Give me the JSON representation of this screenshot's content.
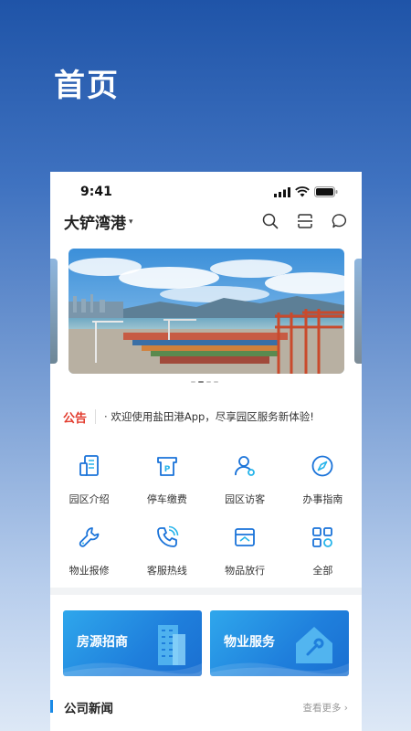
{
  "promo": {
    "title": "首页"
  },
  "status_bar": {
    "time": "9:41"
  },
  "header": {
    "location": "大铲湾港",
    "location_caret": "▾"
  },
  "notice": {
    "tag": "公告",
    "text": "· 欢迎使用盐田港App，尽享园区服务新体验!"
  },
  "services": [
    {
      "label": "园区介绍",
      "icon": "building-doc-icon"
    },
    {
      "label": "停车缴费",
      "icon": "parking-ticket-icon"
    },
    {
      "label": "园区访客",
      "icon": "visitor-icon"
    },
    {
      "label": "办事指南",
      "icon": "compass-icon"
    },
    {
      "label": "物业报修",
      "icon": "wrench-icon"
    },
    {
      "label": "客服热线",
      "icon": "phone-icon"
    },
    {
      "label": "物品放行",
      "icon": "box-release-icon"
    },
    {
      "label": "全部",
      "icon": "grid-all-icon"
    }
  ],
  "cards": [
    {
      "label": "房源招商",
      "icon": "tower-building-icon"
    },
    {
      "label": "物业服务",
      "icon": "house-tool-icon"
    }
  ],
  "news": {
    "title": "公司新闻",
    "more": "查看更多 ›"
  },
  "colors": {
    "accent": "#1a8ae6",
    "notice": "#e23c2e",
    "card": "#1f7fdc"
  }
}
